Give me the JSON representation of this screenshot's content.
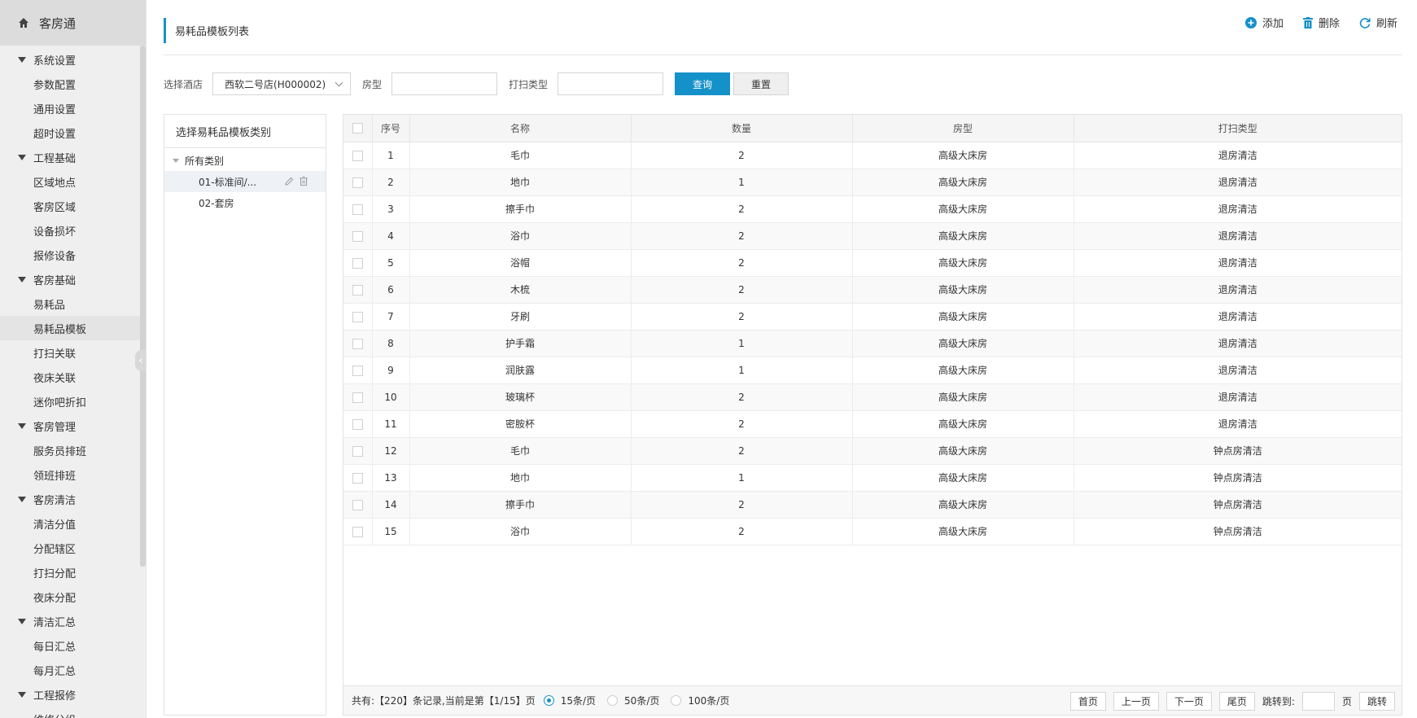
{
  "app": {
    "title": "客房通"
  },
  "sidebar": {
    "groups": [
      {
        "label": "系统设置",
        "items": [
          "参数配置",
          "通用设置",
          "超时设置"
        ]
      },
      {
        "label": "工程基础",
        "items": [
          "区域地点",
          "客房区域",
          "设备损坏",
          "报修设备"
        ]
      },
      {
        "label": "客房基础",
        "items": [
          "易耗品",
          "易耗品模板",
          "打扫关联",
          "夜床关联",
          "迷你吧折扣"
        ]
      },
      {
        "label": "客房管理",
        "items": [
          "服务员排班",
          "领班排班"
        ]
      },
      {
        "label": "客房清洁",
        "items": [
          "清洁分值",
          "分配辖区",
          "打扫分配",
          "夜床分配"
        ]
      },
      {
        "label": "清洁汇总",
        "items": [
          "每日汇总",
          "每月汇总"
        ]
      },
      {
        "label": "工程报修",
        "items": [
          "维修分组"
        ]
      }
    ],
    "active_item": "易耗品模板"
  },
  "header": {
    "title": "易耗品模板列表",
    "add_label": "添加",
    "delete_label": "删除",
    "refresh_label": "刷新"
  },
  "filters": {
    "hotel_label": "选择酒店",
    "hotel_value": "西软二号店(H000002)",
    "room_type_label": "房型",
    "room_type_value": "",
    "clean_type_label": "打扫类型",
    "clean_type_value": "",
    "query_label": "查询",
    "reset_label": "重置"
  },
  "tree": {
    "title": "选择易耗品模板类别",
    "root": "所有类别",
    "nodes": [
      "01-标准间/...",
      "02-套房"
    ]
  },
  "table": {
    "columns": [
      "序号",
      "名称",
      "数量",
      "房型",
      "打扫类型"
    ],
    "rows": [
      [
        "1",
        "毛巾",
        "2",
        "高级大床房",
        "退房清洁"
      ],
      [
        "2",
        "地巾",
        "1",
        "高级大床房",
        "退房清洁"
      ],
      [
        "3",
        "擦手巾",
        "2",
        "高级大床房",
        "退房清洁"
      ],
      [
        "4",
        "浴巾",
        "2",
        "高级大床房",
        "退房清洁"
      ],
      [
        "5",
        "浴帽",
        "2",
        "高级大床房",
        "退房清洁"
      ],
      [
        "6",
        "木梳",
        "2",
        "高级大床房",
        "退房清洁"
      ],
      [
        "7",
        "牙刷",
        "2",
        "高级大床房",
        "退房清洁"
      ],
      [
        "8",
        "护手霜",
        "1",
        "高级大床房",
        "退房清洁"
      ],
      [
        "9",
        "润肤露",
        "1",
        "高级大床房",
        "退房清洁"
      ],
      [
        "10",
        "玻璃杯",
        "2",
        "高级大床房",
        "退房清洁"
      ],
      [
        "11",
        "密胺杯",
        "2",
        "高级大床房",
        "退房清洁"
      ],
      [
        "12",
        "毛巾",
        "2",
        "高级大床房",
        "钟点房清洁"
      ],
      [
        "13",
        "地巾",
        "1",
        "高级大床房",
        "钟点房清洁"
      ],
      [
        "14",
        "擦手巾",
        "2",
        "高级大床房",
        "钟点房清洁"
      ],
      [
        "15",
        "浴巾",
        "2",
        "高级大床房",
        "钟点房清洁"
      ]
    ]
  },
  "pager": {
    "summary": "共有:【220】条记录,当前是第【1/15】页",
    "sizes": [
      "15条/页",
      "50条/页",
      "100条/页"
    ],
    "selected_size": "15条/页",
    "first": "首页",
    "prev": "上一页",
    "next": "下一页",
    "last": "尾页",
    "jump_label": "跳转到:",
    "page_unit": "页",
    "jump_button": "跳转"
  },
  "colors": {
    "accent": "#1591c9",
    "sidebar_bg": "#efefef",
    "brand_bg": "#dcdcdc"
  }
}
